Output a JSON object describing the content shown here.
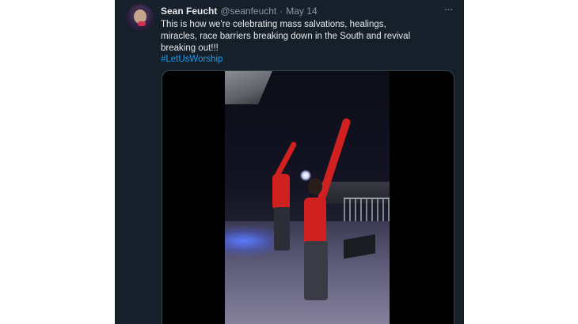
{
  "tweet": {
    "display_name": "Sean Feucht",
    "handle": "@seanfeucht",
    "separator": "·",
    "date": "May 14",
    "more_icon": "···",
    "text": "This is how we're celebrating mass salvations, healings, miracles, race barriers breaking down in the South and revival breaking out!!!",
    "hashtag": "#LetUsWorship"
  },
  "colors": {
    "background": "#15202b",
    "text": "#e7e9ea",
    "muted": "#8b98a5",
    "link": "#1d9bf0",
    "border": "#38444d"
  },
  "icons": {
    "avatar": "profile-avatar",
    "more": "ellipsis-icon"
  }
}
